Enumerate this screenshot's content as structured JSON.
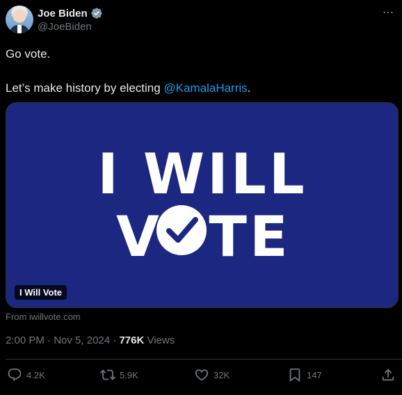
{
  "author": {
    "name": "Joe Biden",
    "handle": "@JoeBiden",
    "verified": true
  },
  "tweet": {
    "line1": "Go vote.",
    "line2_prefix": "Let’s make history by electing ",
    "mention": "@KamalaHarris",
    "line2_suffix": "."
  },
  "card": {
    "headline_line1": "I WILL",
    "headline_line2_start": "V",
    "headline_line2_end": "TE",
    "label": "I Will Vote",
    "background_color": "#1b2781",
    "source": "From iwillvote.com"
  },
  "meta": {
    "time": "2:00 PM",
    "date": "Nov 5, 2024",
    "separator": "·",
    "views_count": "776K",
    "views_label": "Views"
  },
  "actions": {
    "replies": "4.2K",
    "reposts": "5.9K",
    "likes": "32K",
    "bookmarks": "147"
  },
  "icons": [
    "verified-badge-icon",
    "more-icon",
    "reply-icon",
    "repost-icon",
    "like-icon",
    "bookmark-icon",
    "share-icon",
    "checkmark-icon"
  ]
}
